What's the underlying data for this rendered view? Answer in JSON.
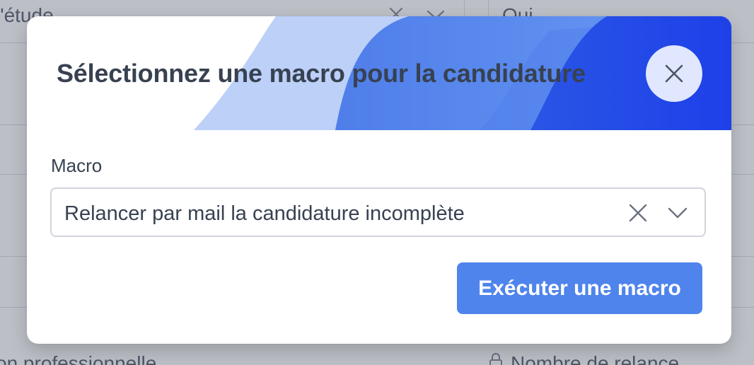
{
  "background": {
    "top_left_text": "l'étude",
    "top_right_text": "Qui",
    "bottom_left_text": "on professionnelle",
    "bottom_right_text": "Nombre de relance",
    "bottom_right_icon": "lock-icon"
  },
  "modal": {
    "title": "Sélectionnez une macro pour la candidature",
    "close_icon": "close-icon",
    "field_label": "Macro",
    "select_value": "Relancer par mail la candidature incomplète",
    "clear_icon": "clear-icon",
    "dropdown_icon": "chevron-down-icon",
    "execute_label": "Exécuter une macro"
  },
  "colors": {
    "accent": "#4f84ec",
    "header_dark": "#1d40e8",
    "header_mid": "#5b8ef2",
    "header_light": "#bcd0f8",
    "title_text": "#374151",
    "close_bg": "#e0e7ff"
  }
}
